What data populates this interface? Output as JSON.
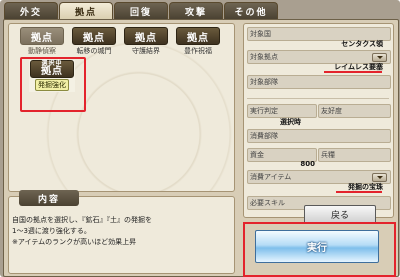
{
  "tabs": [
    {
      "label": "外交",
      "active": false
    },
    {
      "label": "拠点",
      "active": true
    },
    {
      "label": "回復",
      "active": false
    },
    {
      "label": "攻撃",
      "active": false
    },
    {
      "label": "その他",
      "active": false
    }
  ],
  "skills": [
    {
      "head": "拠点",
      "sub": "動静偵察",
      "selected": false,
      "dim": true
    },
    {
      "head": "拠点",
      "sub": "転移の城門",
      "selected": false,
      "dim": false
    },
    {
      "head": "拠点",
      "sub": "守護結界",
      "selected": false,
      "dim": false
    },
    {
      "head": "拠点",
      "sub": "豊作祝福",
      "selected": false,
      "dim": false
    },
    {
      "head": "拠点",
      "sub": "発掘強化",
      "selected": true,
      "dim": false,
      "badge": "選択中"
    }
  ],
  "details": {
    "target_country_label": "対象国",
    "target_country_value": "センタクス領",
    "target_base_label": "対象拠点",
    "target_base_value": "レイムレス要塞",
    "target_unit_label": "対象部隊",
    "exec_decision_label": "実行判定",
    "friendship_label": "友好度",
    "exec_decision_value": "選択時",
    "consume_unit_label": "消費部隊",
    "funds_label": "資金",
    "soldiers_label": "兵糧",
    "funds_value": "800",
    "consume_item_label": "消費アイテム",
    "consume_item_value": "発掘の宝珠",
    "required_skill_label": "必要スキル"
  },
  "content": {
    "title": "内容",
    "line1": "自国の拠点を選択し、『鉱石』『土』の発掘を",
    "line2": "1～3週に渡り強化する。",
    "line3": "※アイテムのランクが高いほど効果上昇"
  },
  "buttons": {
    "back": "戻る",
    "execute": "実行"
  }
}
